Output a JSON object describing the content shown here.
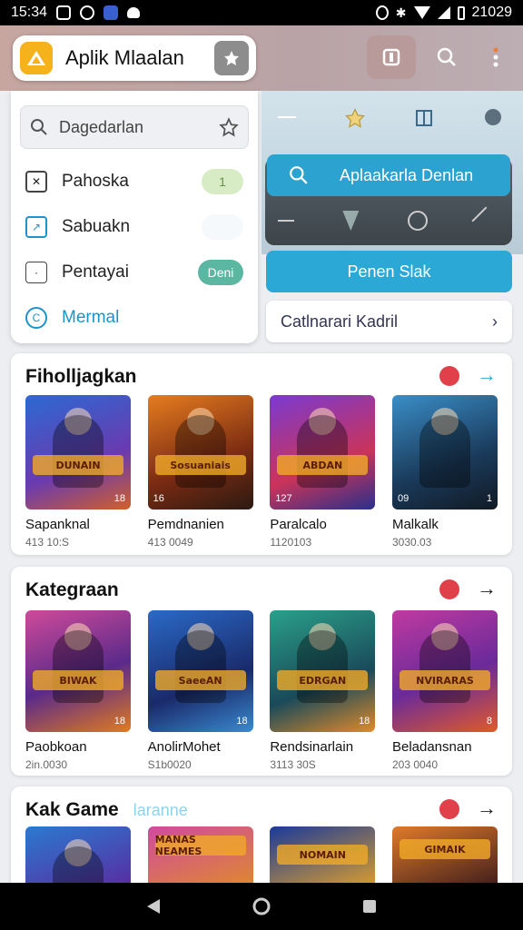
{
  "status_bar": {
    "time": "15:34",
    "right_time": "21029"
  },
  "app_bar": {
    "title": "Aplik Mlaalan"
  },
  "drawer": {
    "search_placeholder": "Dagedarlan",
    "items": [
      {
        "label": "Pahoska",
        "badge": "1"
      },
      {
        "label": "Sabuakn",
        "badge": ""
      },
      {
        "label": "Pentayai",
        "badge": "Deni"
      },
      {
        "label": "Mermal",
        "badge": ""
      }
    ]
  },
  "right_panel": {
    "search_label": "Aplaakarla Denlan",
    "button_label": "Penen Slak",
    "link_label": "Catlnarari Kadril"
  },
  "sections": [
    {
      "title": "Fiholljagkan",
      "subtitle": "",
      "cards": [
        {
          "title": "Sapanknal",
          "meta": "413 10:S",
          "banner": "DUNAIN",
          "tag_left": "",
          "tag_right": "18"
        },
        {
          "title": "Pemdnanien",
          "meta": "413 0049",
          "banner": "Sosuaniais",
          "tag_left": "16",
          "tag_right": ""
        },
        {
          "title": "Paralcalo",
          "meta": "1120103",
          "banner": "ABDAN",
          "tag_left": "127",
          "tag_right": ""
        },
        {
          "title": "Malkalk",
          "meta": "3030.03",
          "banner": "",
          "tag_left": "09",
          "tag_right": "1"
        }
      ]
    },
    {
      "title": "Kategraan",
      "subtitle": "",
      "cards": [
        {
          "title": "Paobkoan",
          "meta": "2in.0030",
          "banner": "BIWAK",
          "tag_left": "",
          "tag_right": "18"
        },
        {
          "title": "AnolirMohet",
          "meta": "S1b0020",
          "banner": "SaeeAN",
          "tag_left": "",
          "tag_right": "18"
        },
        {
          "title": "Rendsinarlain",
          "meta": "3113 30S",
          "banner": "EDRGAN",
          "tag_left": "",
          "tag_right": "18"
        },
        {
          "title": "Beladansnan",
          "meta": "203 0040",
          "banner": "NVIRARAS",
          "tag_left": "",
          "tag_right": "8"
        }
      ]
    },
    {
      "title": "Kak Game",
      "subtitle": "laranne",
      "cards": [
        {
          "title": "",
          "meta": "",
          "banner": "",
          "tag_left": "",
          "tag_right": ""
        },
        {
          "title": "",
          "meta": "",
          "banner": "MANAS NEAMES",
          "tag_left": "",
          "tag_right": ""
        },
        {
          "title": "",
          "meta": "",
          "banner": "NOMAIN",
          "tag_left": "",
          "tag_right": ""
        },
        {
          "title": "",
          "meta": "",
          "banner": "GIMAIK",
          "tag_left": "",
          "tag_right": ""
        }
      ]
    }
  ],
  "colors": {
    "accent": "#2ca8d6",
    "logo": "#f5b21b",
    "badge_red": "#e0404a",
    "teal_badge": "#5bb7a1"
  },
  "icons": [
    "search-icon",
    "star-icon",
    "more-icon",
    "tabs-icon",
    "back-icon",
    "home-icon",
    "recents-icon",
    "arrow-right-icon",
    "chevron-right-icon"
  ]
}
